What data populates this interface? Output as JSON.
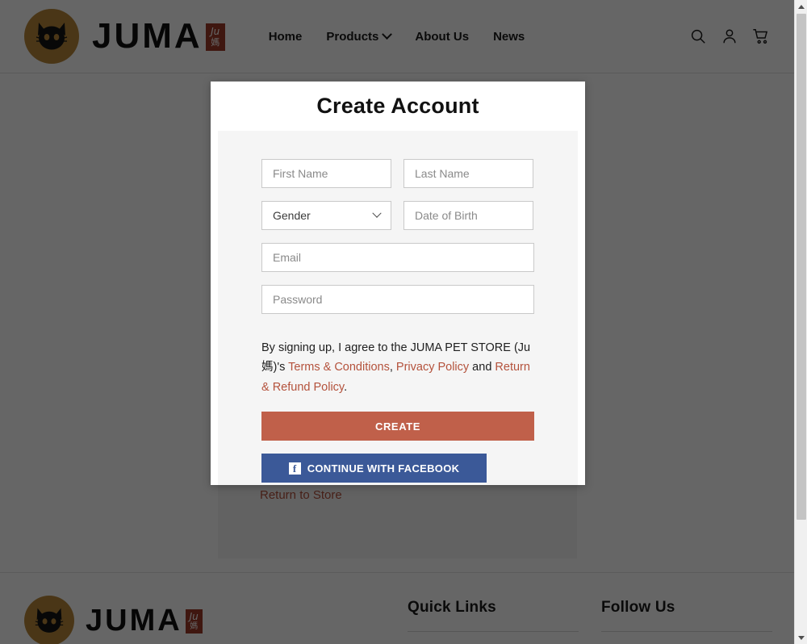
{
  "header": {
    "logo": {
      "alt": "juma-cat-logo",
      "circle_color": "#b8883a"
    },
    "wordmark": "JUMA",
    "stamp_top": "Ju",
    "stamp_bottom": "媽",
    "nav": [
      {
        "label": "Home",
        "has_dropdown": false
      },
      {
        "label": "Products",
        "has_dropdown": true
      },
      {
        "label": "About Us",
        "has_dropdown": false
      },
      {
        "label": "News",
        "has_dropdown": false
      }
    ],
    "icons": [
      "search-icon",
      "account-icon",
      "cart-icon"
    ]
  },
  "background_page": {
    "return_to_store": "Return to Store"
  },
  "modal": {
    "title": "Create Account",
    "fields": {
      "first_name_placeholder": "First Name",
      "last_name_placeholder": "Last Name",
      "gender_value": "Gender",
      "dob_placeholder": "Date of Birth",
      "email_placeholder": "Email",
      "password_placeholder": "Password"
    },
    "terms": {
      "lead": "By signing up, I agree to the JUMA PET STORE (Ju媽)'s ",
      "link1": "Terms & Conditions",
      "sep1": ", ",
      "link2": "Privacy Policy",
      "conj": " and ",
      "link3": "Return & Refund Policy",
      "end": "."
    },
    "create_button": "CREATE",
    "facebook_button": "CONTINUE WITH FACEBOOK",
    "facebook_mark": "f"
  },
  "footer": {
    "wordmark": "JUMA",
    "stamp_top": "Ju",
    "stamp_bottom": "媽",
    "quick_links_title": "Quick Links",
    "follow_us_title": "Follow Us",
    "quick_links": [],
    "follow_links": []
  },
  "colors": {
    "brand_gold": "#b8883a",
    "accent_terracotta": "#c0604a",
    "facebook_blue": "#3b5998",
    "link_red": "#b4523c",
    "overlay": "rgba(0,0,0,0.6)"
  },
  "scrollbar": {
    "up_arrow": "scroll-up",
    "down_arrow": "scroll-down"
  }
}
